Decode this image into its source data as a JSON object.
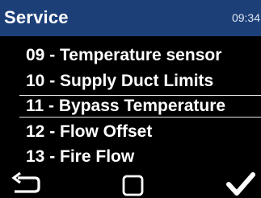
{
  "header": {
    "title": "Service",
    "time": "09:34"
  },
  "menu": {
    "items": [
      {
        "label": "09 - Temperature sensor",
        "selected": false
      },
      {
        "label": "10 - Supply Duct Limits",
        "selected": false
      },
      {
        "label": "11 - Bypass Temperature",
        "selected": true
      },
      {
        "label": "12 - Flow Offset",
        "selected": false
      },
      {
        "label": "13 - Fire Flow",
        "selected": false
      }
    ]
  },
  "footer": {
    "left_icon": "back-arrow-icon",
    "center_icon": "square-icon",
    "right_icon": "checkmark-icon"
  },
  "colors": {
    "header_bg": "#1c3f78",
    "background": "#000000",
    "text": "#ffffff"
  }
}
